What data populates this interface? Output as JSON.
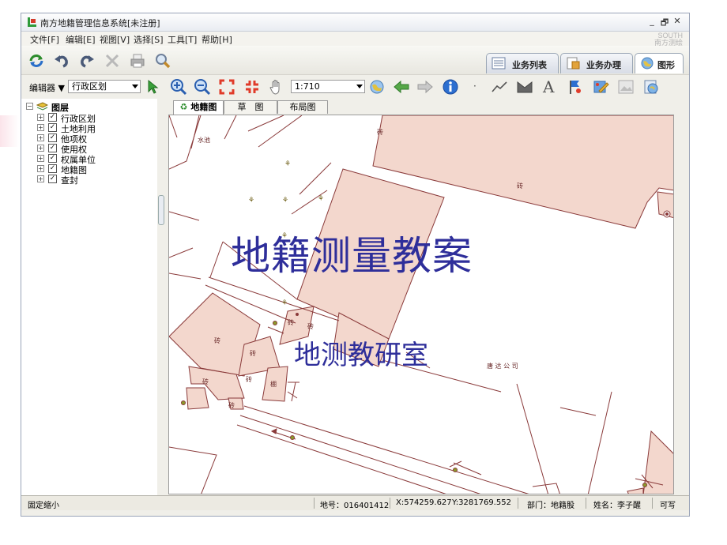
{
  "window": {
    "title": "南方地籍管理信息系统[未注册]",
    "controls": [
      "_",
      "🗗",
      "✕"
    ],
    "brand": "SOUTH"
  },
  "menu": [
    "文件[F]",
    "编辑[E]",
    "视图[V]",
    "选择[S]",
    "工具[T]",
    "帮助[H]"
  ],
  "main_tabs": [
    {
      "label": "业务列表",
      "icon": "list-icon"
    },
    {
      "label": "业务办理",
      "icon": "document-icon"
    },
    {
      "label": "图形",
      "icon": "globe-icon"
    }
  ],
  "toolbar2": {
    "editor_label": "编辑器 ▼",
    "layer_select": "行政区划",
    "scale_select": "1:710"
  },
  "layer_tree": {
    "root": "图层",
    "items": [
      "行政区划",
      "土地利用",
      "他项权",
      "使用权",
      "权属单位",
      "地籍图",
      "查封"
    ]
  },
  "map_tabs": [
    "地籍图",
    "草　图",
    "布局图"
  ],
  "map_labels": {
    "shuichi": "水池",
    "zhuan": "砖",
    "company": "唐 达 公 司",
    "pen": "棚"
  },
  "overlay": {
    "main": "地籍测量教案",
    "sub": "地测教研室"
  },
  "status": {
    "mode": "固定缩小",
    "parcel": "地号：016401412",
    "x": "X:574259.627",
    "y": "Y:3281769.552",
    "dept": "部门：地籍股",
    "name": "姓名：李子醒",
    "rw": "可写"
  }
}
